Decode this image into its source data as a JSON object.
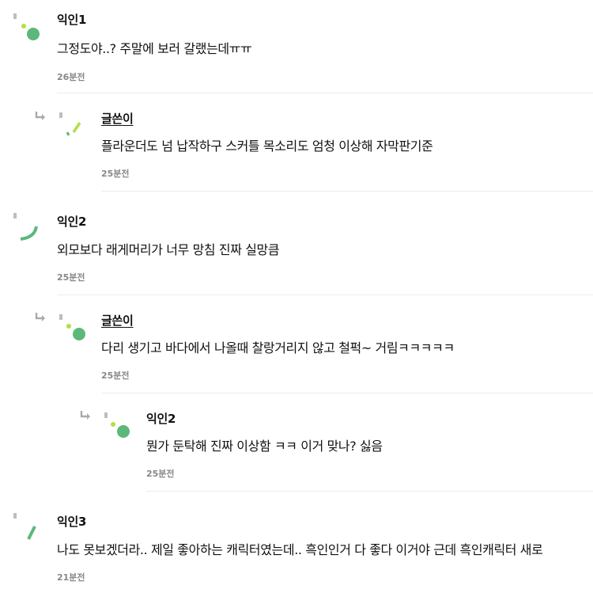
{
  "comments": [
    {
      "name": "익인1",
      "text": "그정도야..? 주말에 보러 갈랬는데ㅠㅠ",
      "time": "26분전"
    },
    {
      "name": "글쓴이",
      "text": "플라운더도 넘 납작하구 스커틀 목소리도 엄청 이상해 자막판기준",
      "time": "25분전"
    },
    {
      "name": "익인2",
      "text": "외모보다 래게머리가 너무 망침 진짜 실망큼",
      "time": "25분전"
    },
    {
      "name": "글쓴이",
      "text": "다리 생기고 바다에서 나올때 찰랑거리지 않고 철퍽~ 거림ㅋㅋㅋㅋㅋ",
      "time": "25분전"
    },
    {
      "name": "익인2",
      "text": "뭔가 둔탁해 진짜 이상함 ㅋㅋ 이거 맞나? 싫음",
      "time": "25분전"
    },
    {
      "name": "익인3",
      "text": "나도 못보겠더라.. 제일 좋아하는 캐릭터였는데.. 흑인인거 다 좋다 이거야 근데 흑인캐릭터 새로",
      "time": "21분전"
    }
  ],
  "icons": {
    "avatar": "random-avatar-icon",
    "reply": "reply-arrow-icon"
  },
  "colors": {
    "green": "#5cb87a",
    "lime": "#b5dd45",
    "gray": "#9a9a9a"
  }
}
